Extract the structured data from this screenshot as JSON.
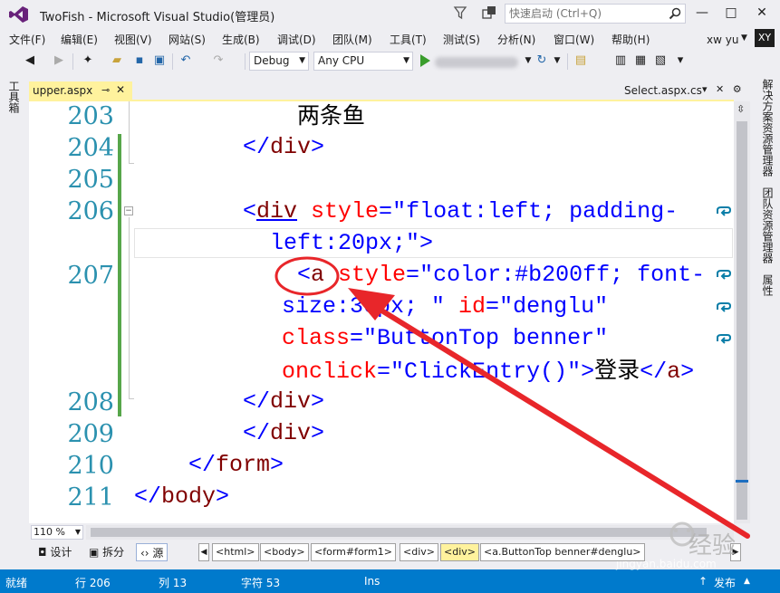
{
  "window": {
    "title": "TwoFish - Microsoft Visual Studio(管理员)",
    "quick_launch_placeholder": "快速启动 (Ctrl+Q)",
    "minimize": "—",
    "restore": "□",
    "close": "✕"
  },
  "menu": [
    "文件(F)",
    "编辑(E)",
    "视图(V)",
    "网站(S)",
    "生成(B)",
    "调试(D)",
    "团队(M)",
    "工具(T)",
    "测试(S)",
    "分析(N)",
    "窗口(W)",
    "帮助(H)"
  ],
  "user": {
    "name": "xw yu",
    "initials": "XY"
  },
  "toolbar": {
    "configuration": "Debug",
    "platform": "Any CPU"
  },
  "left_strip": {
    "toolbox": "工具箱"
  },
  "right_strip": {
    "solution_explorer": "解决方案资源管理器",
    "team_explorer": "团队资源管理器",
    "properties": "属性"
  },
  "tabs": {
    "active": {
      "label": "upper.aspx",
      "pin": "⊸",
      "close": "✕"
    },
    "right": {
      "label": "Select.aspx.cs",
      "icons": "▾ ✕ ⚙"
    }
  },
  "editor": {
    "line_numbers": [
      "203",
      "204",
      "205",
      "206",
      "207",
      "208",
      "209",
      "210",
      "211"
    ],
    "lines": {
      "l203_text": "两条鱼",
      "l204_close": "</",
      "l204_tag": "div",
      "l204_end": ">",
      "l206_open": "<",
      "l206_tag": "div",
      "l206_attr": " style",
      "l206_eq": "=",
      "l206_val1": "\"float:left; padding-",
      "l206b_val2": "left:20px;\"",
      "l206b_end": ">",
      "l207_open": "<",
      "l207_tag": "a",
      "l207_attr": " style",
      "l207_eq": "=",
      "l207_val1": "\"color:#b200ff; font-",
      "l207b_val2": "size:30px; \"",
      "l207b_attr": " id",
      "l207b_eq": "=",
      "l207b_val": "\"denglu\"",
      "l207c_attr": "class",
      "l207c_eq": "=",
      "l207c_val": "\"ButtonTop benner\"",
      "l207d_attr": "onclick",
      "l207d_eq": "=",
      "l207d_val": "\"ClickEntry()\"",
      "l207d_gt": ">",
      "l207d_text": "登录",
      "l207d_close": "</",
      "l207d_tag": "a",
      "l207d_end": ">",
      "l208_close": "</",
      "l208_tag": "div",
      "l208_end": ">",
      "l209_close": "</",
      "l209_tag": "div",
      "l209_end": ">",
      "l210_close": "</",
      "l210_tag": "form",
      "l210_end": ">",
      "l211_close": "</",
      "l211_tag": "body",
      "l211_end": ">"
    }
  },
  "zoom": "110 %",
  "views": {
    "design": "设计",
    "split": "拆分",
    "source": "源"
  },
  "breadcrumbs": [
    "<html>",
    "<body>",
    "<form#form1>",
    "<div>",
    "<div>",
    "<a.ButtonTop benner#denglu>"
  ],
  "status": {
    "ready": "就绪",
    "line": "行 206",
    "col": "列 13",
    "char": "字符 53",
    "mode": "Ins",
    "publish": "发布"
  },
  "watermark": {
    "brand": "经验",
    "url": "jingyan.baidu.com"
  },
  "colors": {
    "accent": "#007acc",
    "tab_active": "#fff29d",
    "annotation": "#e8262a",
    "change_bar": "#57a64a"
  }
}
